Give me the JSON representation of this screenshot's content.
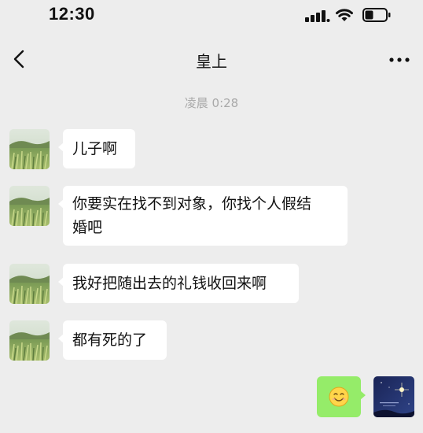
{
  "status_bar": {
    "time": "12:30",
    "signal_icon": "signal-bars-icon",
    "wifi_icon": "wifi-icon",
    "battery_icon": "battery-icon",
    "battery_level": 0.4
  },
  "nav": {
    "title": "皇上",
    "back_icon": "chevron-left-icon",
    "more_icon": "more-dots-icon"
  },
  "chat": {
    "timestamp": "凌晨 0:28",
    "messages": [
      {
        "sender": "other",
        "text": "儿子啊"
      },
      {
        "sender": "other",
        "line1": "你要实在找不到对象，你找个人假结",
        "line2": "婚吧"
      },
      {
        "sender": "other",
        "text": "我好把随出去的礼钱收回来啊"
      },
      {
        "sender": "other",
        "text": "都有死的了"
      },
      {
        "sender": "me",
        "emoji": "😊",
        "icon": "smile-emoji-icon"
      }
    ]
  },
  "colors": {
    "background": "#ededed",
    "bubble_other": "#ffffff",
    "bubble_me": "#95ec69",
    "timestamp": "#a9a9a9"
  }
}
